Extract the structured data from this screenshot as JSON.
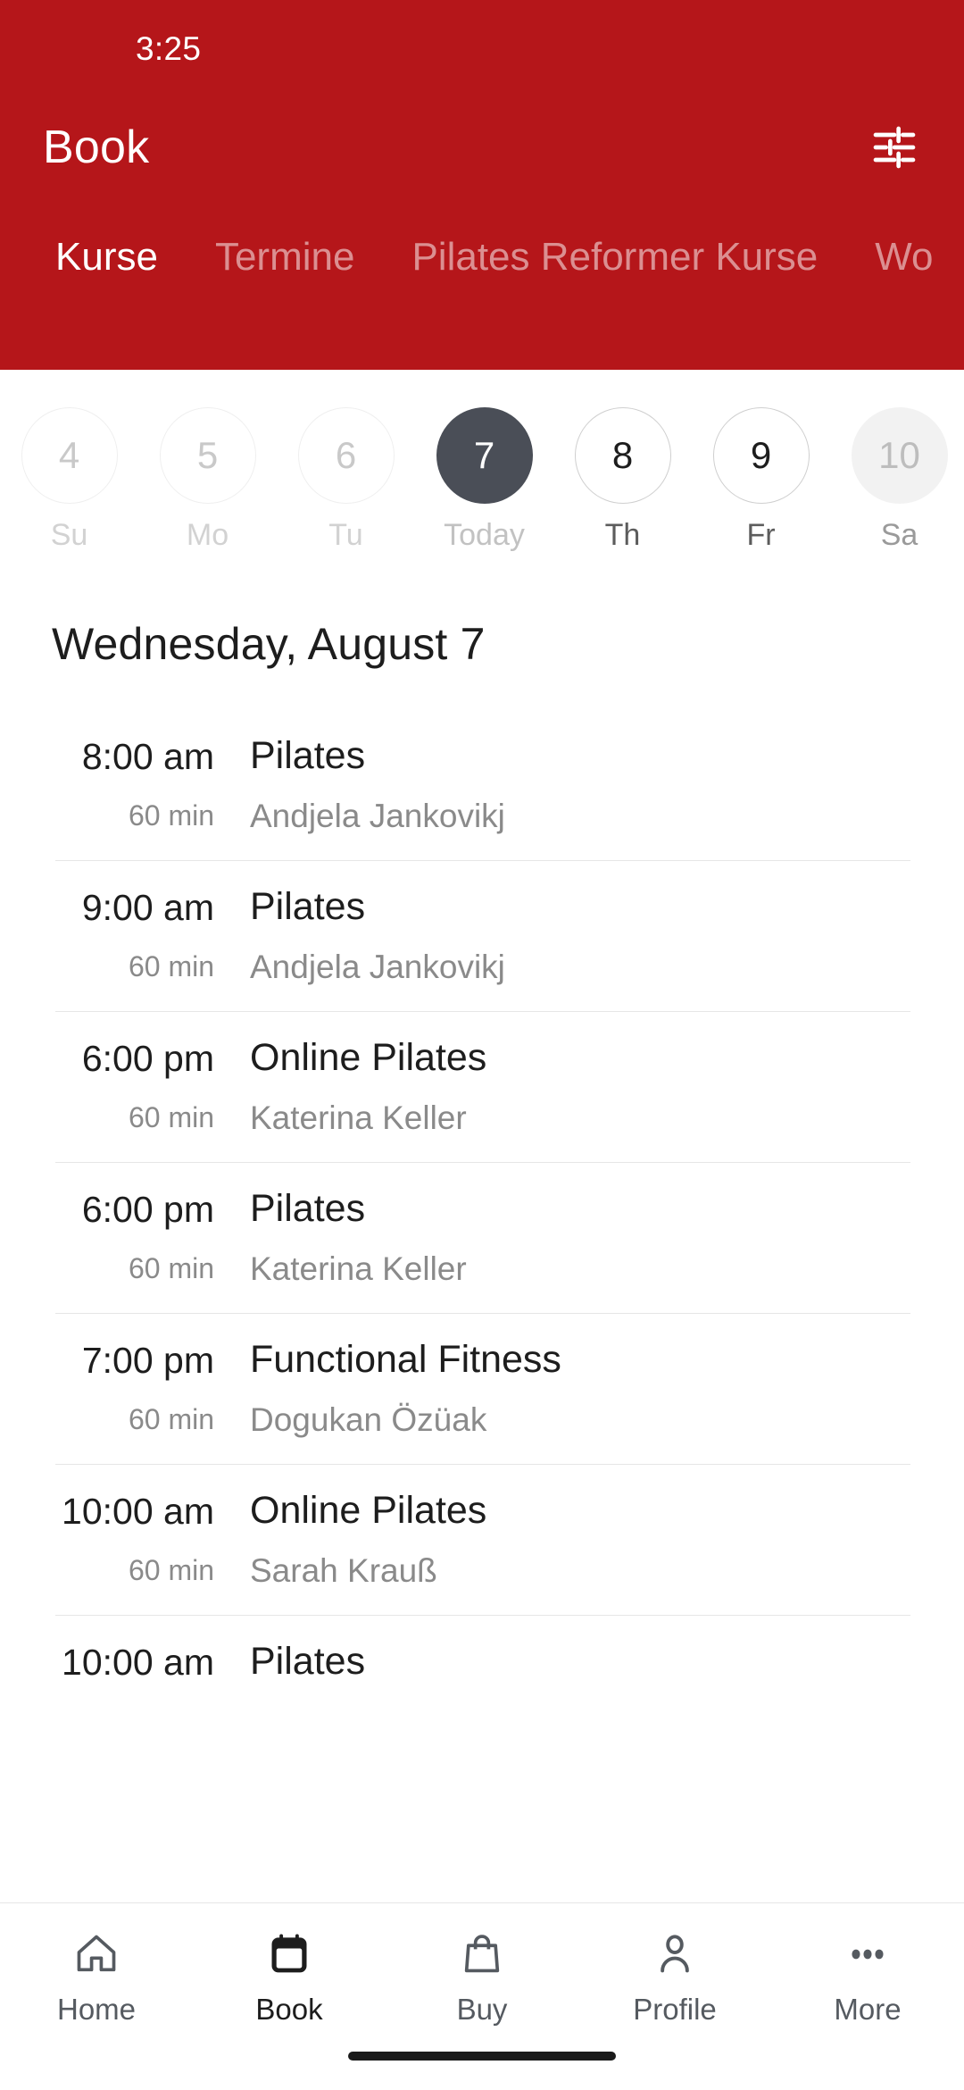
{
  "status": {
    "time": "3:25"
  },
  "header": {
    "title": "Book",
    "filter_icon": "tune-filter-icon",
    "background_color": "#B5161A"
  },
  "tabs": [
    {
      "label": "Kurse",
      "active": true
    },
    {
      "label": "Termine",
      "active": false
    },
    {
      "label": "Pilates Reformer Kurse",
      "active": false
    },
    {
      "label": "Wo",
      "active": false
    }
  ],
  "date_strip": [
    {
      "day": "4",
      "weekday": "Su",
      "state": "past"
    },
    {
      "day": "5",
      "weekday": "Mo",
      "state": "past"
    },
    {
      "day": "6",
      "weekday": "Tu",
      "state": "past"
    },
    {
      "day": "7",
      "weekday": "Today",
      "state": "today"
    },
    {
      "day": "8",
      "weekday": "Th",
      "state": "normal"
    },
    {
      "day": "9",
      "weekday": "Fr",
      "state": "normal"
    },
    {
      "day": "10",
      "weekday": "Sa",
      "state": "filled"
    }
  ],
  "day_title": "Wednesday, August 7",
  "schedule": [
    {
      "time": "8:00 am",
      "duration": "60 min",
      "name": "Pilates",
      "coach": "Andjela Jankovikj"
    },
    {
      "time": "9:00 am",
      "duration": "60 min",
      "name": "Pilates",
      "coach": "Andjela Jankovikj"
    },
    {
      "time": "6:00 pm",
      "duration": "60 min",
      "name": "Online Pilates",
      "coach": "Katerina Keller"
    },
    {
      "time": "6:00 pm",
      "duration": "60 min",
      "name": "Pilates",
      "coach": "Katerina Keller"
    },
    {
      "time": "7:00 pm",
      "duration": "60 min",
      "name": "Functional Fitness",
      "coach": "Dogukan Özüak"
    },
    {
      "time": "10:00 am",
      "duration": "60 min",
      "name": "Online Pilates",
      "coach": "Sarah Krauß"
    },
    {
      "time": "10:00 am",
      "duration": "",
      "name": "Pilates",
      "coach": ""
    }
  ],
  "bottom_nav": [
    {
      "label": "Home",
      "icon": "home-icon",
      "active": false
    },
    {
      "label": "Book",
      "icon": "calendar-icon",
      "active": true
    },
    {
      "label": "Buy",
      "icon": "bag-icon",
      "active": false
    },
    {
      "label": "Profile",
      "icon": "person-icon",
      "active": false
    },
    {
      "label": "More",
      "icon": "ellipsis-icon",
      "active": false
    }
  ],
  "colors": {
    "brand_red": "#B5161A",
    "selected_date": "#4A4E57",
    "text_primary": "#1D1D1D",
    "text_muted": "#8A8A8A",
    "divider": "#E6E6E6"
  }
}
